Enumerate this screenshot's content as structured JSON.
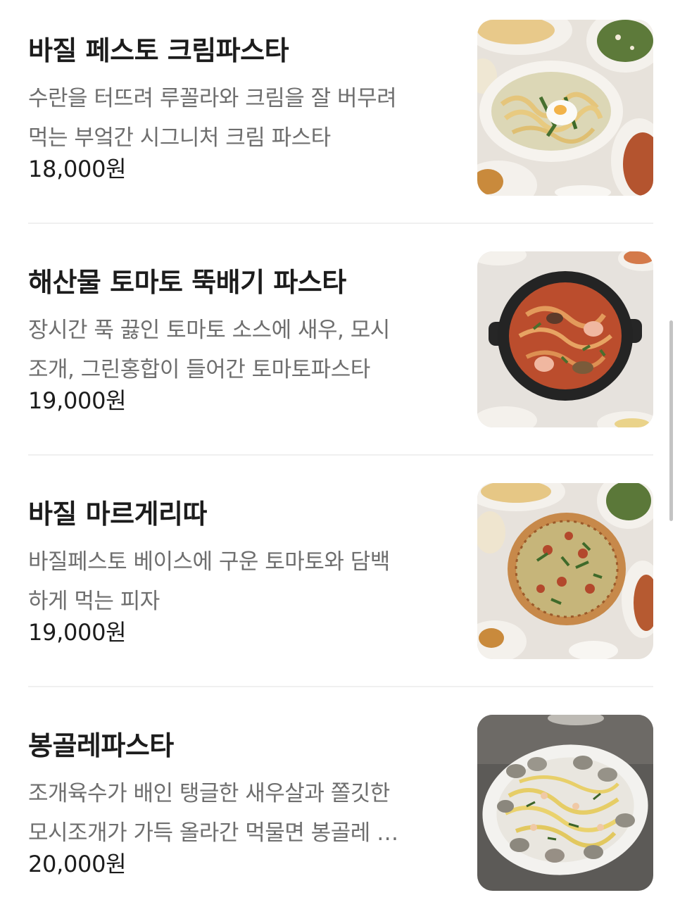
{
  "menu": {
    "items": [
      {
        "name": "바질 페스토 크림파스타",
        "desc_line1": "수란을 터뜨려 루꼴라와 크림을 잘 버무려",
        "desc_line2": "먹는 부엌간 시그니처 크림 파스타",
        "price": "18,000원",
        "image": "basil-pesto-cream-pasta-photo"
      },
      {
        "name": "해산물 토마토 뚝배기 파스타",
        "desc_line1": "장시간 푹 끓인 토마토 소스에 새우, 모시",
        "desc_line2": "조개, 그린홍합이 들어간 토마토파스타",
        "price": "19,000원",
        "image": "seafood-tomato-pasta-photo"
      },
      {
        "name": "바질 마르게리따",
        "desc_line1": "바질페스토 베이스에 구운 토마토와 담백",
        "desc_line2": "하게 먹는 피자",
        "price": "19,000원",
        "image": "basil-margherita-pizza-photo"
      },
      {
        "name": "봉골레파스타",
        "desc_line1": "조개육수가 배인 탱글한 새우살과 쫄깃한",
        "desc_line2": "모시조개가 가득 올라간 먹물면 봉골레 …",
        "price": "20,000원",
        "image": "vongole-pasta-photo"
      }
    ]
  },
  "colors": {
    "text_primary": "#1c1c1c",
    "text_secondary": "#6e6e6e",
    "divider": "#f0f0f0",
    "scrollbar": "#c4c4c4"
  }
}
